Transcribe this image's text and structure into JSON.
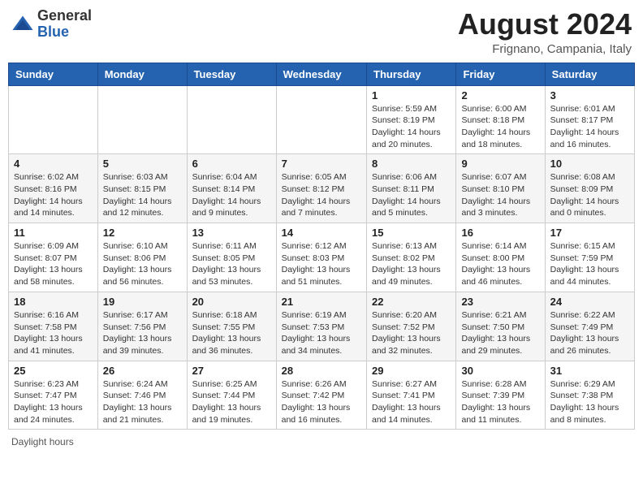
{
  "header": {
    "logo_general": "General",
    "logo_blue": "Blue",
    "month_year": "August 2024",
    "location": "Frignano, Campania, Italy"
  },
  "weekdays": [
    "Sunday",
    "Monday",
    "Tuesday",
    "Wednesday",
    "Thursday",
    "Friday",
    "Saturday"
  ],
  "weeks": [
    [
      {
        "day": "",
        "info": ""
      },
      {
        "day": "",
        "info": ""
      },
      {
        "day": "",
        "info": ""
      },
      {
        "day": "",
        "info": ""
      },
      {
        "day": "1",
        "info": "Sunrise: 5:59 AM\nSunset: 8:19 PM\nDaylight: 14 hours and 20 minutes."
      },
      {
        "day": "2",
        "info": "Sunrise: 6:00 AM\nSunset: 8:18 PM\nDaylight: 14 hours and 18 minutes."
      },
      {
        "day": "3",
        "info": "Sunrise: 6:01 AM\nSunset: 8:17 PM\nDaylight: 14 hours and 16 minutes."
      }
    ],
    [
      {
        "day": "4",
        "info": "Sunrise: 6:02 AM\nSunset: 8:16 PM\nDaylight: 14 hours and 14 minutes."
      },
      {
        "day": "5",
        "info": "Sunrise: 6:03 AM\nSunset: 8:15 PM\nDaylight: 14 hours and 12 minutes."
      },
      {
        "day": "6",
        "info": "Sunrise: 6:04 AM\nSunset: 8:14 PM\nDaylight: 14 hours and 9 minutes."
      },
      {
        "day": "7",
        "info": "Sunrise: 6:05 AM\nSunset: 8:12 PM\nDaylight: 14 hours and 7 minutes."
      },
      {
        "day": "8",
        "info": "Sunrise: 6:06 AM\nSunset: 8:11 PM\nDaylight: 14 hours and 5 minutes."
      },
      {
        "day": "9",
        "info": "Sunrise: 6:07 AM\nSunset: 8:10 PM\nDaylight: 14 hours and 3 minutes."
      },
      {
        "day": "10",
        "info": "Sunrise: 6:08 AM\nSunset: 8:09 PM\nDaylight: 14 hours and 0 minutes."
      }
    ],
    [
      {
        "day": "11",
        "info": "Sunrise: 6:09 AM\nSunset: 8:07 PM\nDaylight: 13 hours and 58 minutes."
      },
      {
        "day": "12",
        "info": "Sunrise: 6:10 AM\nSunset: 8:06 PM\nDaylight: 13 hours and 56 minutes."
      },
      {
        "day": "13",
        "info": "Sunrise: 6:11 AM\nSunset: 8:05 PM\nDaylight: 13 hours and 53 minutes."
      },
      {
        "day": "14",
        "info": "Sunrise: 6:12 AM\nSunset: 8:03 PM\nDaylight: 13 hours and 51 minutes."
      },
      {
        "day": "15",
        "info": "Sunrise: 6:13 AM\nSunset: 8:02 PM\nDaylight: 13 hours and 49 minutes."
      },
      {
        "day": "16",
        "info": "Sunrise: 6:14 AM\nSunset: 8:00 PM\nDaylight: 13 hours and 46 minutes."
      },
      {
        "day": "17",
        "info": "Sunrise: 6:15 AM\nSunset: 7:59 PM\nDaylight: 13 hours and 44 minutes."
      }
    ],
    [
      {
        "day": "18",
        "info": "Sunrise: 6:16 AM\nSunset: 7:58 PM\nDaylight: 13 hours and 41 minutes."
      },
      {
        "day": "19",
        "info": "Sunrise: 6:17 AM\nSunset: 7:56 PM\nDaylight: 13 hours and 39 minutes."
      },
      {
        "day": "20",
        "info": "Sunrise: 6:18 AM\nSunset: 7:55 PM\nDaylight: 13 hours and 36 minutes."
      },
      {
        "day": "21",
        "info": "Sunrise: 6:19 AM\nSunset: 7:53 PM\nDaylight: 13 hours and 34 minutes."
      },
      {
        "day": "22",
        "info": "Sunrise: 6:20 AM\nSunset: 7:52 PM\nDaylight: 13 hours and 32 minutes."
      },
      {
        "day": "23",
        "info": "Sunrise: 6:21 AM\nSunset: 7:50 PM\nDaylight: 13 hours and 29 minutes."
      },
      {
        "day": "24",
        "info": "Sunrise: 6:22 AM\nSunset: 7:49 PM\nDaylight: 13 hours and 26 minutes."
      }
    ],
    [
      {
        "day": "25",
        "info": "Sunrise: 6:23 AM\nSunset: 7:47 PM\nDaylight: 13 hours and 24 minutes."
      },
      {
        "day": "26",
        "info": "Sunrise: 6:24 AM\nSunset: 7:46 PM\nDaylight: 13 hours and 21 minutes."
      },
      {
        "day": "27",
        "info": "Sunrise: 6:25 AM\nSunset: 7:44 PM\nDaylight: 13 hours and 19 minutes."
      },
      {
        "day": "28",
        "info": "Sunrise: 6:26 AM\nSunset: 7:42 PM\nDaylight: 13 hours and 16 minutes."
      },
      {
        "day": "29",
        "info": "Sunrise: 6:27 AM\nSunset: 7:41 PM\nDaylight: 13 hours and 14 minutes."
      },
      {
        "day": "30",
        "info": "Sunrise: 6:28 AM\nSunset: 7:39 PM\nDaylight: 13 hours and 11 minutes."
      },
      {
        "day": "31",
        "info": "Sunrise: 6:29 AM\nSunset: 7:38 PM\nDaylight: 13 hours and 8 minutes."
      }
    ]
  ],
  "legend": "Daylight hours"
}
